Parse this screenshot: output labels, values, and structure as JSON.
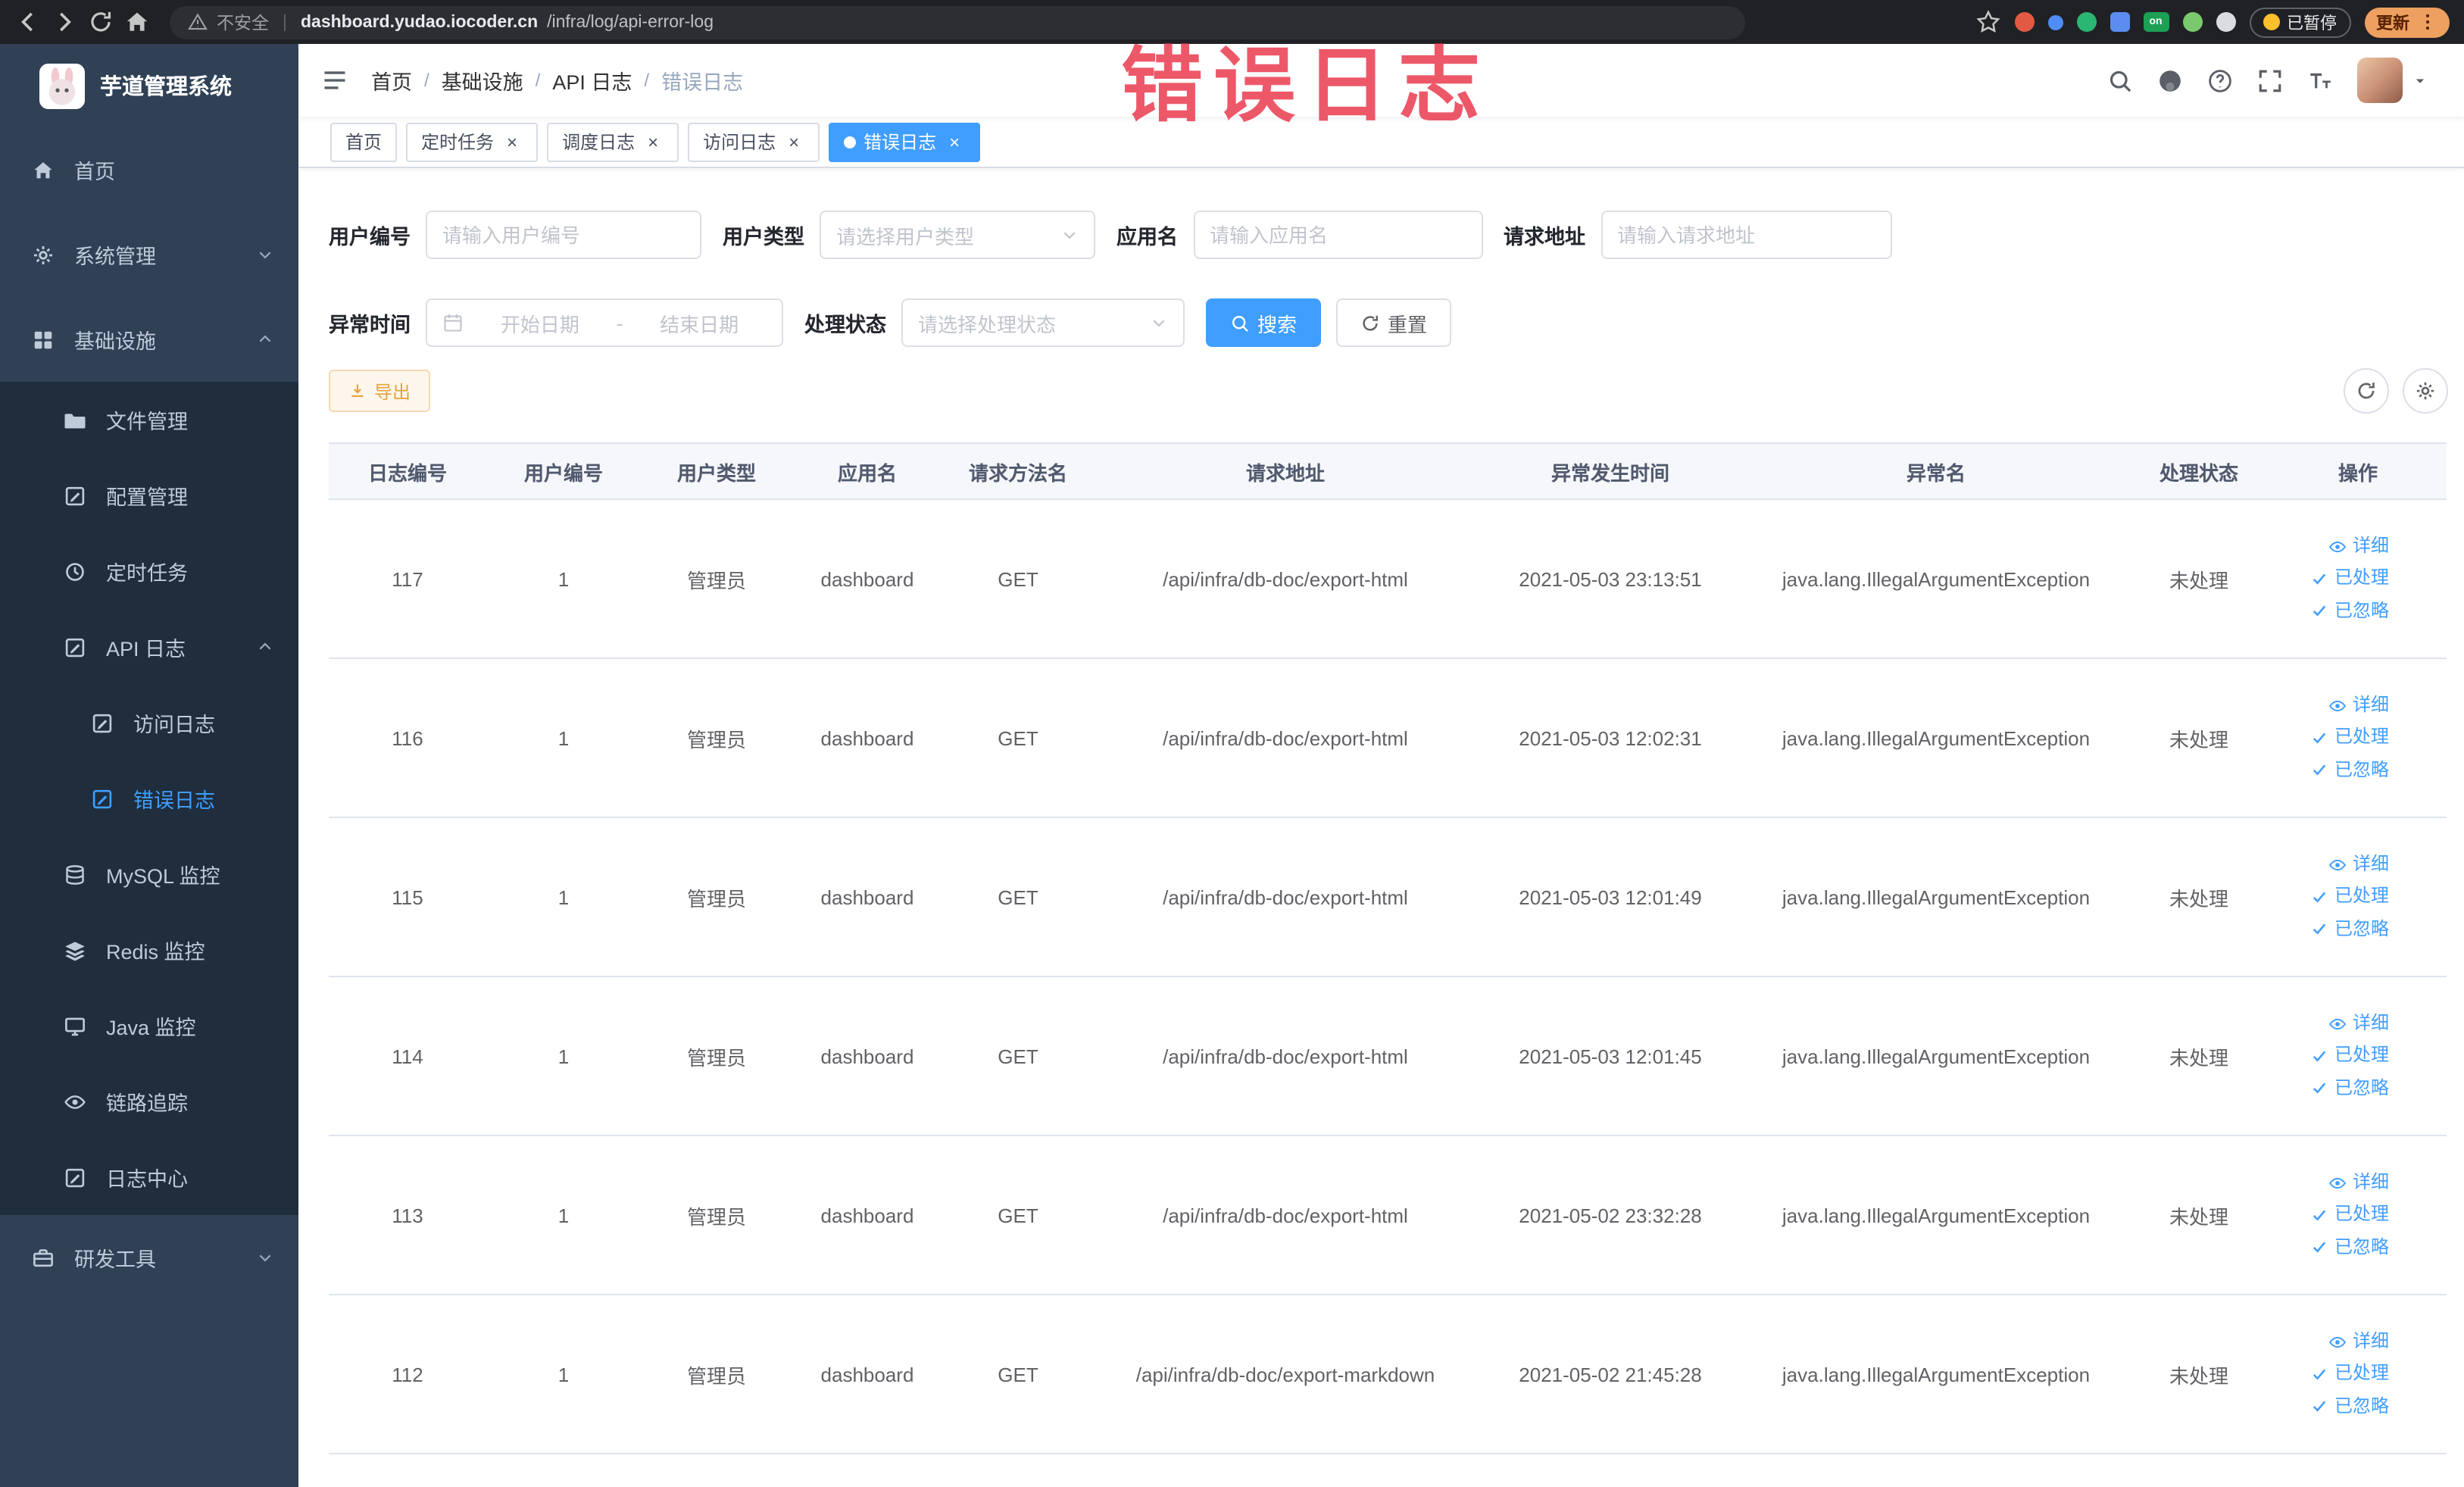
{
  "browser": {
    "security_label": "不安全",
    "url_domain": "dashboard.yudao.iocoder.cn",
    "url_path": "/infra/log/api-error-log",
    "extension_badge": "on",
    "paused_label": "已暂停",
    "update_label": "更新"
  },
  "annotation": {
    "text": "错误日志"
  },
  "sidebar": {
    "logo_title": "芋道管理系统",
    "items": [
      {
        "label": "首页",
        "level": 1,
        "icon": "home-icon"
      },
      {
        "label": "系统管理",
        "level": 1,
        "icon": "gear-icon",
        "chevron": "down"
      },
      {
        "label": "基础设施",
        "level": 1,
        "icon": "grid-icon",
        "chevron": "up"
      },
      {
        "label": "文件管理",
        "level": 2,
        "icon": "folder-icon"
      },
      {
        "label": "配置管理",
        "level": 2,
        "icon": "edit-doc-icon"
      },
      {
        "label": "定时任务",
        "level": 2,
        "icon": "clock-icon"
      },
      {
        "label": "API 日志",
        "level": 2,
        "icon": "edit-doc-icon",
        "chevron": "up"
      },
      {
        "label": "访问日志",
        "level": 3,
        "icon": "edit-doc-icon"
      },
      {
        "label": "错误日志",
        "level": 3,
        "icon": "edit-doc-icon",
        "active": true
      },
      {
        "label": "MySQL 监控",
        "level": 2,
        "icon": "database-icon"
      },
      {
        "label": "Redis 监控",
        "level": 2,
        "icon": "layers-icon"
      },
      {
        "label": "Java 监控",
        "level": 2,
        "icon": "monitor-icon"
      },
      {
        "label": "链路追踪",
        "level": 2,
        "icon": "eye-icon"
      },
      {
        "label": "日志中心",
        "level": 2,
        "icon": "edit-doc-icon"
      },
      {
        "label": "研发工具",
        "level": 1,
        "icon": "toolbox-icon",
        "chevron": "down"
      }
    ]
  },
  "breadcrumb": [
    "首页",
    "基础设施",
    "API 日志",
    "错误日志"
  ],
  "tabs": [
    {
      "label": "首页",
      "closable": false,
      "active": false
    },
    {
      "label": "定时任务",
      "closable": true,
      "active": false
    },
    {
      "label": "调度日志",
      "closable": true,
      "active": false
    },
    {
      "label": "访问日志",
      "closable": true,
      "active": false
    },
    {
      "label": "错误日志",
      "closable": true,
      "active": true
    }
  ],
  "filters": {
    "user_id": {
      "label": "用户编号",
      "placeholder": "请输入用户编号"
    },
    "user_type": {
      "label": "用户类型",
      "placeholder": "请选择用户类型"
    },
    "app_name": {
      "label": "应用名",
      "placeholder": "请输入应用名"
    },
    "request_url": {
      "label": "请求地址",
      "placeholder": "请输入请求地址"
    },
    "exception_time": {
      "label": "异常时间",
      "start_placeholder": "开始日期",
      "separator": "-",
      "end_placeholder": "结束日期"
    },
    "process_status": {
      "label": "处理状态",
      "placeholder": "请选择处理状态"
    },
    "search_label": "搜索",
    "reset_label": "重置"
  },
  "toolbar": {
    "export_label": "导出"
  },
  "table": {
    "columns": [
      "日志编号",
      "用户编号",
      "用户类型",
      "应用名",
      "请求方法名",
      "请求地址",
      "异常发生时间",
      "异常名",
      "处理状态",
      "操作"
    ],
    "actions": [
      "详细",
      "已处理",
      "已忽略"
    ],
    "rows": [
      {
        "id": "117",
        "user_id": "1",
        "user_type": "管理员",
        "app": "dashboard",
        "method": "GET",
        "url": "/api/infra/db-doc/export-html",
        "time": "2021-05-03 23:13:51",
        "exception": "java.lang.IllegalArgumentException",
        "status": "未处理"
      },
      {
        "id": "116",
        "user_id": "1",
        "user_type": "管理员",
        "app": "dashboard",
        "method": "GET",
        "url": "/api/infra/db-doc/export-html",
        "time": "2021-05-03 12:02:31",
        "exception": "java.lang.IllegalArgumentException",
        "status": "未处理"
      },
      {
        "id": "115",
        "user_id": "1",
        "user_type": "管理员",
        "app": "dashboard",
        "method": "GET",
        "url": "/api/infra/db-doc/export-html",
        "time": "2021-05-03 12:01:49",
        "exception": "java.lang.IllegalArgumentException",
        "status": "未处理"
      },
      {
        "id": "114",
        "user_id": "1",
        "user_type": "管理员",
        "app": "dashboard",
        "method": "GET",
        "url": "/api/infra/db-doc/export-html",
        "time": "2021-05-03 12:01:45",
        "exception": "java.lang.IllegalArgumentException",
        "status": "未处理"
      },
      {
        "id": "113",
        "user_id": "1",
        "user_type": "管理员",
        "app": "dashboard",
        "method": "GET",
        "url": "/api/infra/db-doc/export-html",
        "time": "2021-05-02 23:32:28",
        "exception": "java.lang.IllegalArgumentException",
        "status": "未处理"
      },
      {
        "id": "112",
        "user_id": "1",
        "user_type": "管理员",
        "app": "dashboard",
        "method": "GET",
        "url": "/api/infra/db-doc/export-markdown",
        "time": "2021-05-02 21:45:28",
        "exception": "java.lang.IllegalArgumentException",
        "status": "未处理"
      }
    ]
  },
  "colors": {
    "accent": "#409eff",
    "sidebar_bg": "#304156",
    "submenu_bg": "#1f2d3d",
    "warning": "#e6a23c",
    "annotation": "#ea3b50"
  }
}
